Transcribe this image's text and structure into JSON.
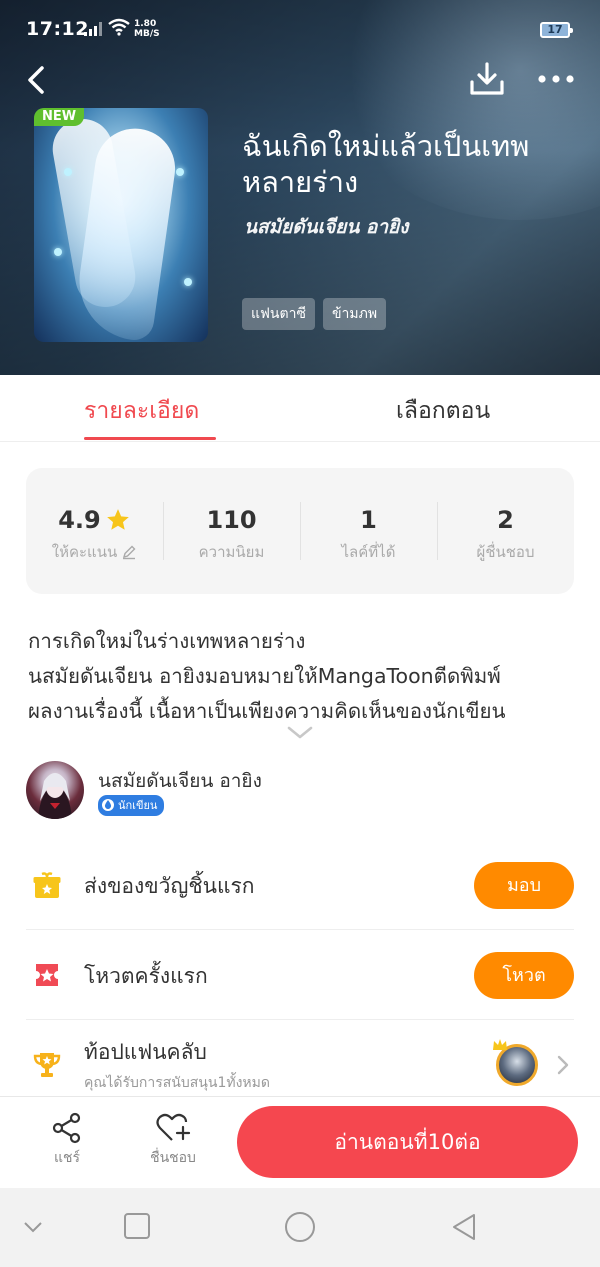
{
  "status_bar": {
    "time": "17:12",
    "speed_value": "1.80",
    "speed_unit": "MB/S",
    "battery": "17"
  },
  "header": {
    "new_badge": "NEW",
    "title": "ฉันเกิดใหม่แล้วเป็นเทพหลายร่าง",
    "author": "นสมัยดันเจียน อายิง",
    "tags": [
      "แฟนตาซี",
      "ข้ามภพ"
    ]
  },
  "tabs": {
    "detail": "รายละเอียด",
    "episodes": "เลือกตอน",
    "active": "detail"
  },
  "stats": [
    {
      "value": "4.9",
      "label": "ให้คะแนน"
    },
    {
      "value": "110",
      "label": "ความนิยม"
    },
    {
      "value": "1",
      "label": "ไลค์ที่ได้"
    },
    {
      "value": "2",
      "label": "ผู้ชื่นชอบ"
    }
  ],
  "description": {
    "line1": "การเกิดใหม่ในร่างเทพหลายร่าง",
    "line2": "นสมัยดันเจียน อายิงมอบหมายให้MangaToonตีดพิมพ์",
    "line3": "ผลงานเรื่องนี้ เนื้อหาเป็นเพียงความคิดเห็นของนักเขียน"
  },
  "author_block": {
    "name": "นสมัยดันเจียน อายิง",
    "badge": "นักเขียน"
  },
  "actions": {
    "gift": {
      "label": "ส่งของขวัญชิ้นแรก",
      "button": "มอบ"
    },
    "vote": {
      "label": "โหวตครั้งแรก",
      "button": "โหวต"
    },
    "fanclub": {
      "label": "ท้อปแฟนคลับ",
      "sub": "คุณได้รับการสนับสนุน1ทั้งหมด"
    }
  },
  "bottom_bar": {
    "share": "แชร์",
    "like": "ชื่นชอบ",
    "read": "อ่านตอนที่10ต่อ"
  },
  "colors": {
    "accent_red": "#f5474f",
    "tab_red": "#f0494f",
    "orange": "#ff8a00",
    "new_green": "#5fbf2e",
    "writer_blue": "#2f7de1",
    "star": "#f7c51b"
  },
  "icons": [
    "back-icon",
    "download-icon",
    "more-icon",
    "star-icon",
    "edit-icon",
    "chevron-down-icon",
    "gift-icon",
    "ticket-icon",
    "trophy-icon",
    "crown-icon",
    "chevron-right-icon",
    "share-icon",
    "heart-plus-icon",
    "nav-down-icon",
    "nav-square-icon",
    "nav-circle-icon",
    "nav-back-icon"
  ]
}
